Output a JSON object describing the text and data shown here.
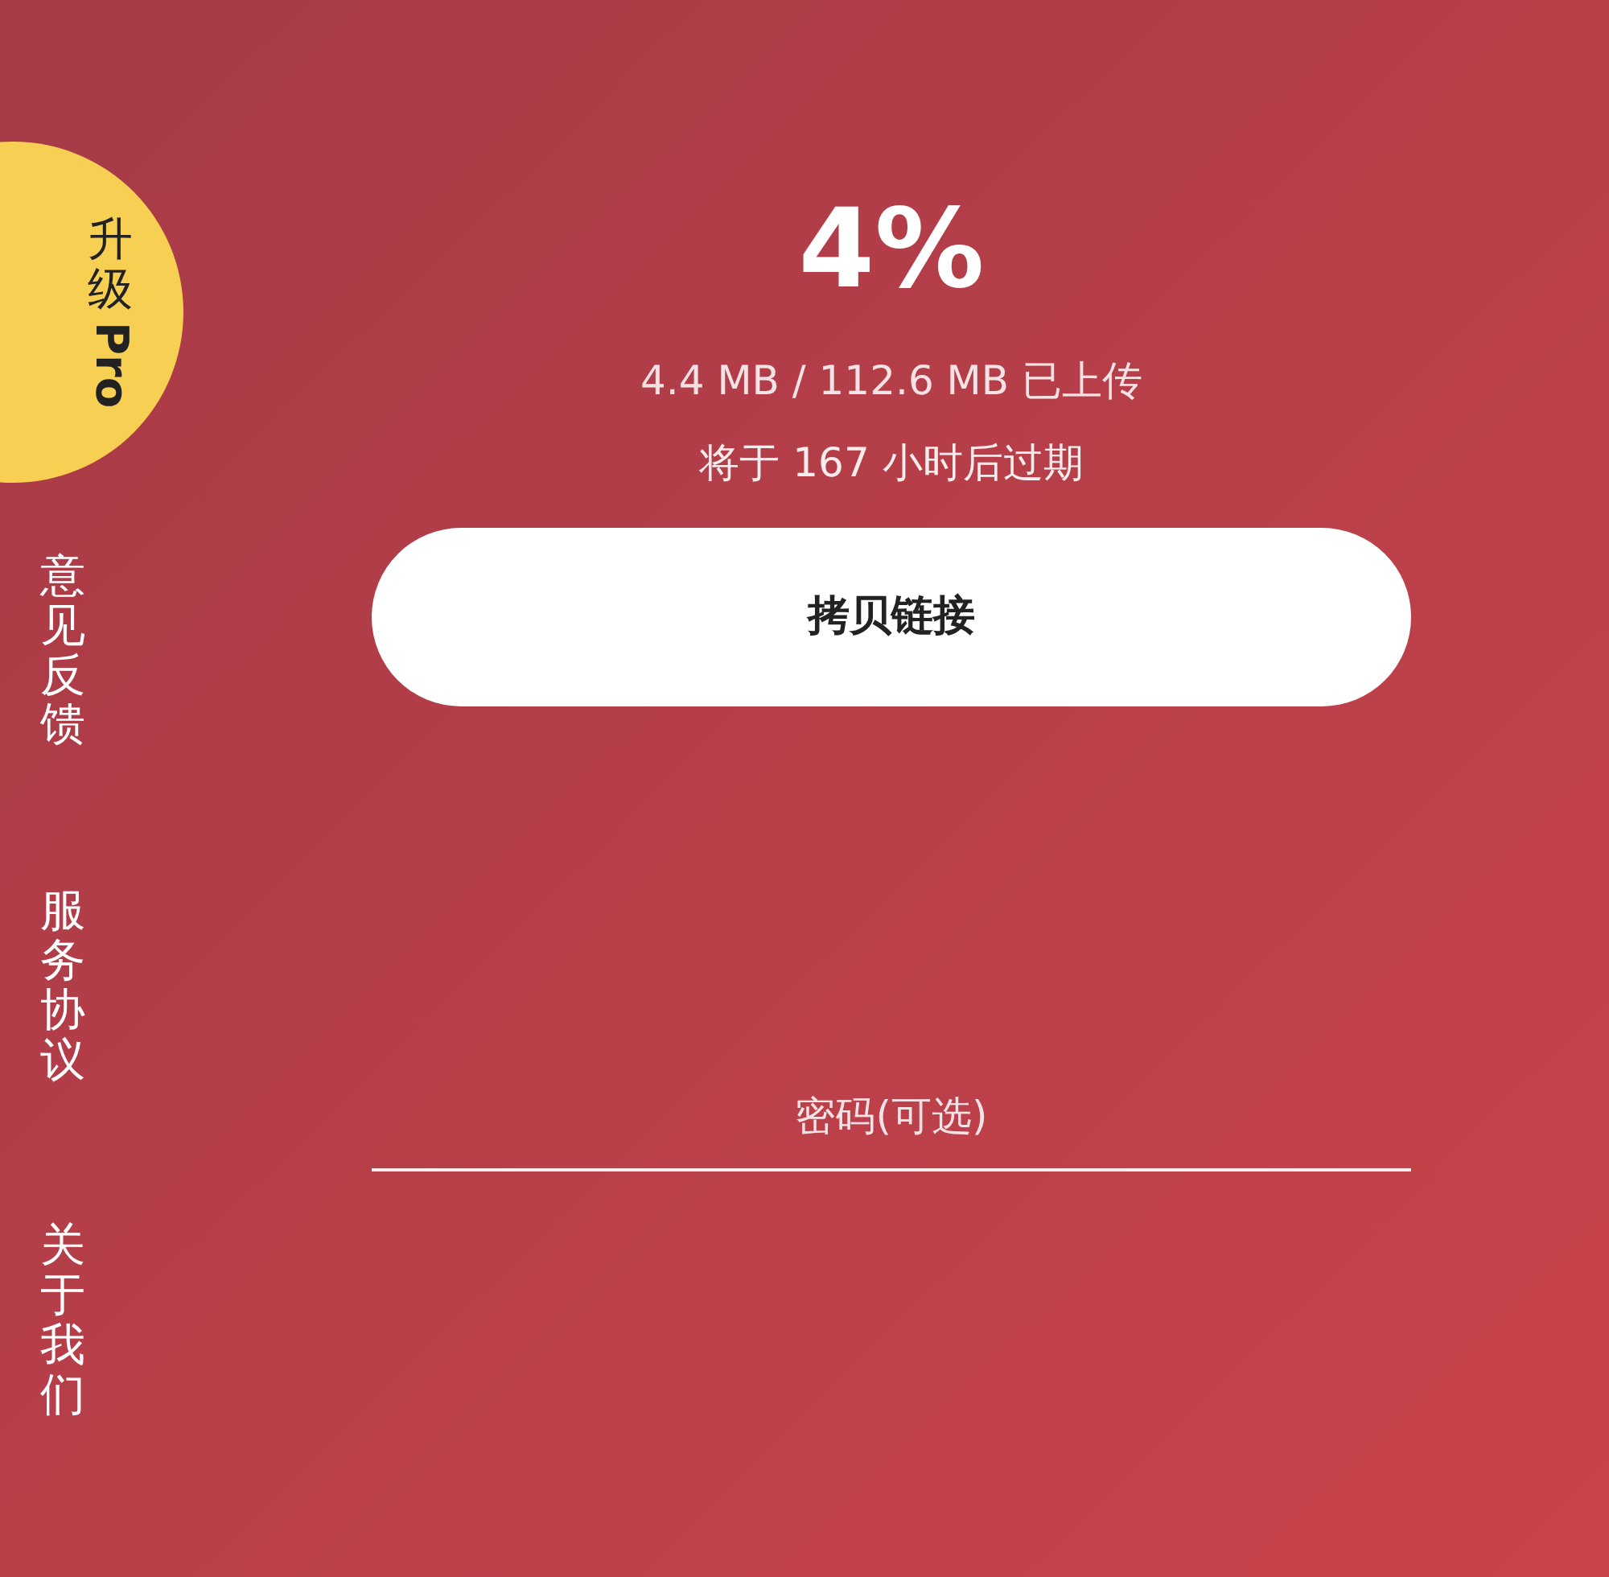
{
  "sidebar": {
    "upgrade_badge": {
      "text": "升级Pro"
    },
    "items": [
      {
        "label": "意见反馈"
      },
      {
        "label": "服务协议"
      },
      {
        "label": "关于我们"
      }
    ]
  },
  "upload": {
    "percent": "4%",
    "size": "4.4 MB / 112.6 MB 已上传",
    "expiry": "将于 167 小时后过期"
  },
  "copy_button": {
    "label": "拷贝链接"
  },
  "password_field": {
    "placeholder": "密码(可选)"
  }
}
